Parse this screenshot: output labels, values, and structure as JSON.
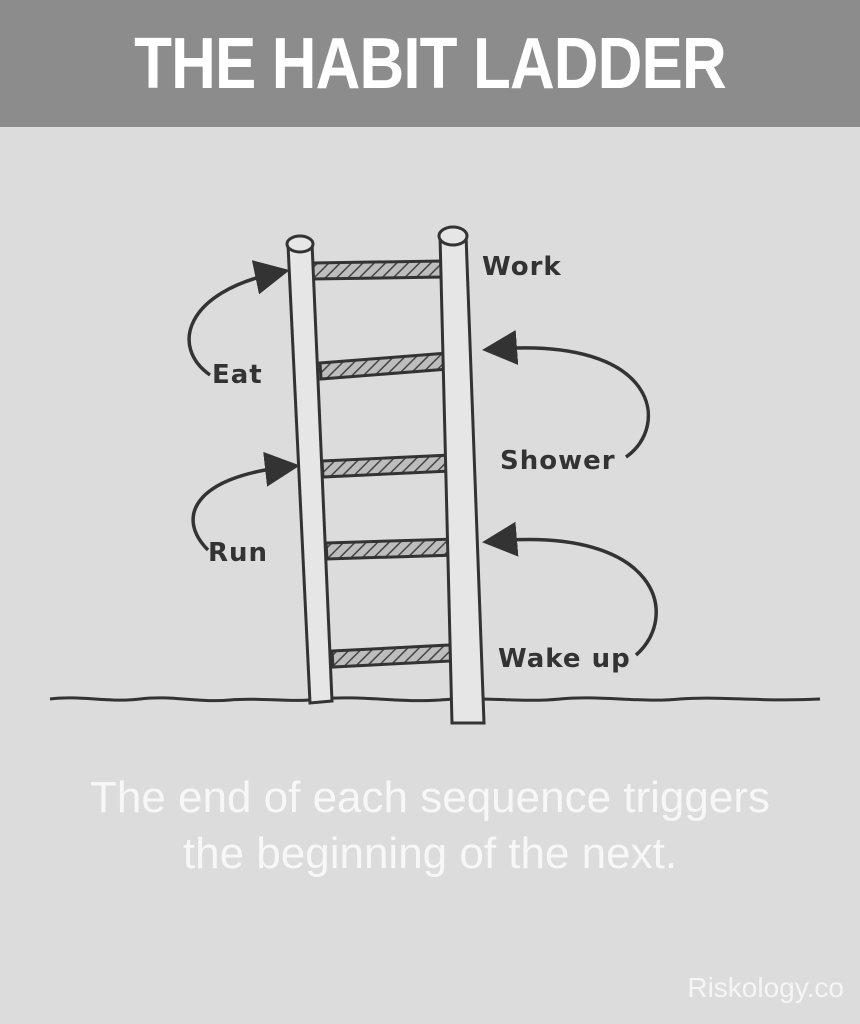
{
  "title": "THE HABIT LADDER",
  "ladder": {
    "steps_left": [
      "Eat",
      "Run"
    ],
    "steps_right": [
      "Work",
      "Shower",
      "Wake up"
    ]
  },
  "caption": {
    "line1": "The end of each sequence triggers",
    "line2": "the beginning of the next."
  },
  "credit": "Riskology.co",
  "colors": {
    "banner": "#8c8c8c",
    "background": "#dcdcdc",
    "ink": "#333333",
    "caption_text": "#f7f7f7"
  }
}
